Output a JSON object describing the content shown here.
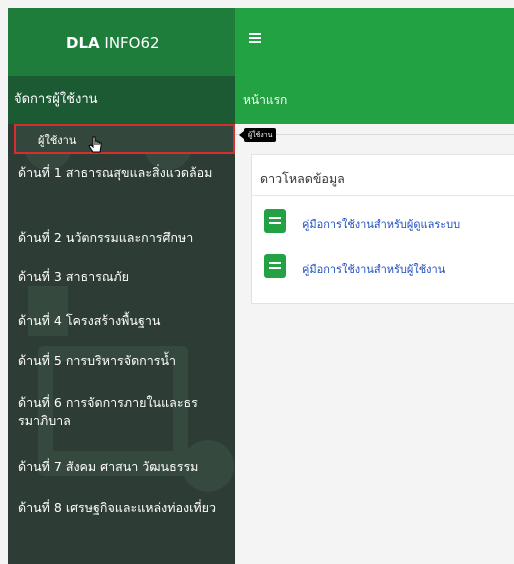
{
  "header": {
    "brand": "DLA",
    "brand_suffix": " INFO62",
    "menu_icon": "hamburger-icon"
  },
  "sidebar": {
    "section_title": "จัดการผู้ใช้งาน",
    "active_subitem": "ผู้ใช้งาน",
    "items": [
      {
        "label": "ด้านที่ 1 สาธารณสุขและสิ่งแวดล้อม"
      },
      {
        "label": "ด้านที่ 2 นวัตกรรมและการศึกษา"
      },
      {
        "label": "ด้านที่ 3 สาธารณภัย"
      },
      {
        "label": "ด้านที่ 4 โครงสร้างพื้นฐาน"
      },
      {
        "label": "ด้านที่ 5 การบริหารจัดการน้ำ"
      },
      {
        "label": "ด้านที่ 6 การจัดการภายในและธรรมาภิบาล"
      },
      {
        "label": "ด้านที่ 7 สังคม ศาสนา วัฒนธรรม"
      },
      {
        "label": "ด้านที่ 8 เศรษฐกิจและแหล่งท่องเที่ยว"
      }
    ]
  },
  "main": {
    "page_title": "หน้าแรก",
    "tooltip": "ผู้ใช้งาน",
    "download_title": "ดาวโหลดข้อมูล",
    "links": [
      {
        "label": "คู่มือการใช้งานสำหรับผู้ดูแลระบบ",
        "icon": "document-icon"
      },
      {
        "label": "คู่มือการใช้งานสำหรับผู้ใช้งาน",
        "icon": "document-icon"
      }
    ]
  },
  "colors": {
    "topbar_dark": "#1e7d3a",
    "topbar_green": "#23a244",
    "sidebar_bg": "#2d3c35",
    "highlight_border": "#d32f2f",
    "link": "#1f4fbf",
    "doc_icon": "#23a244"
  }
}
